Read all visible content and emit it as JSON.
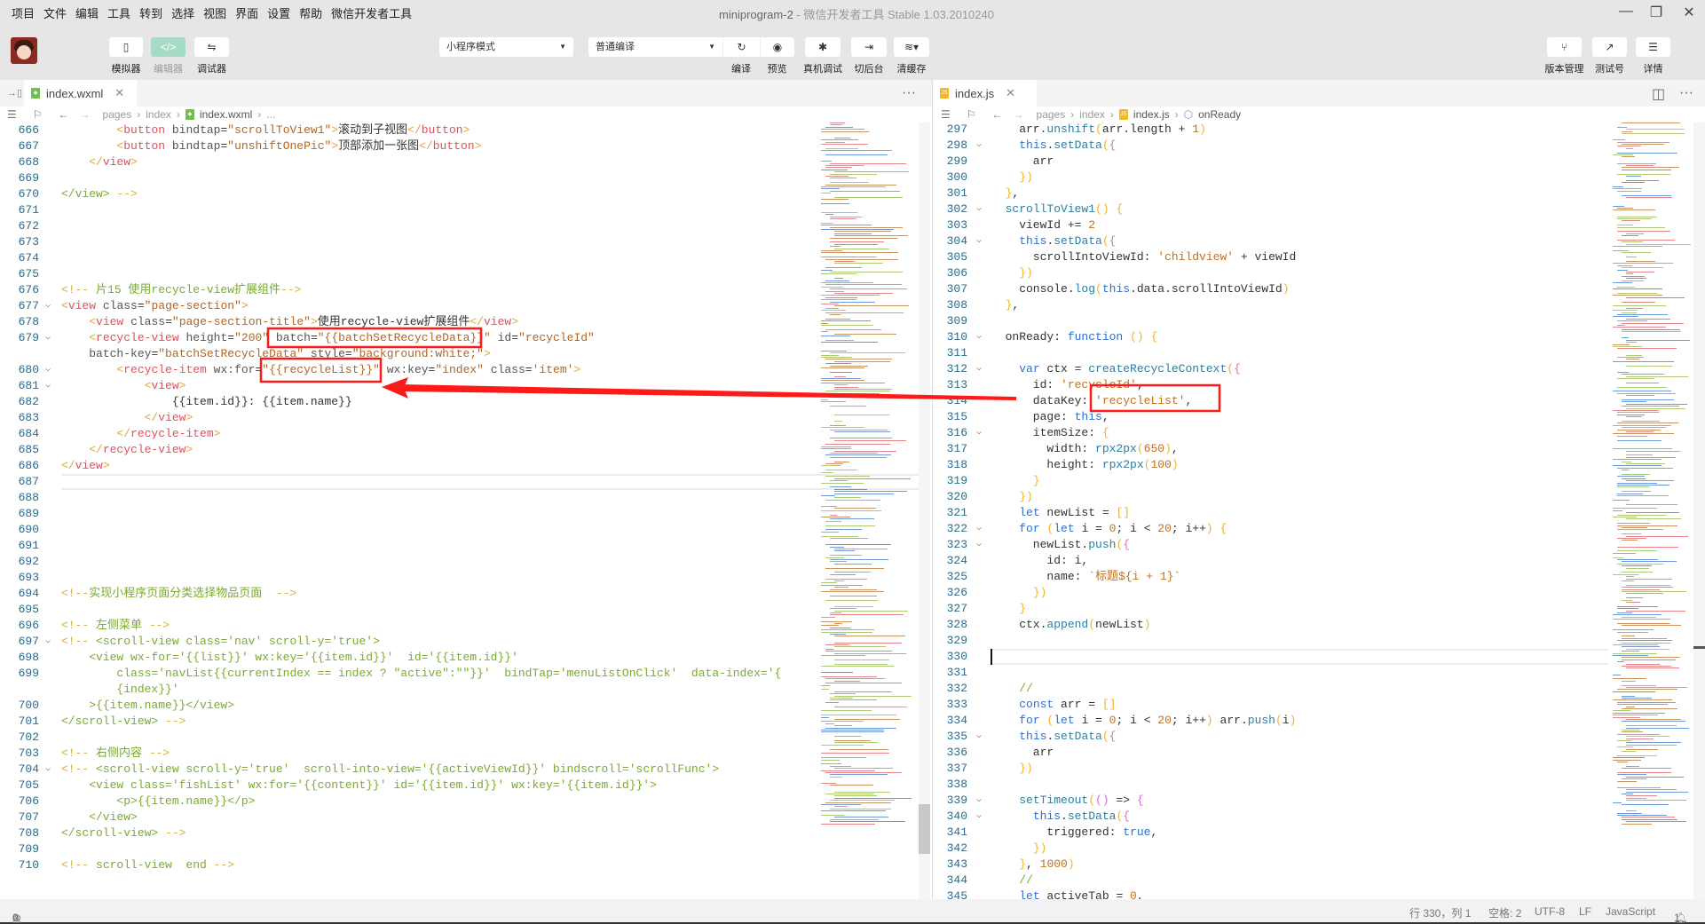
{
  "menu": [
    "项目",
    "文件",
    "编辑",
    "工具",
    "转到",
    "选择",
    "视图",
    "界面",
    "设置",
    "帮助",
    "微信开发者工具"
  ],
  "window": {
    "app_name": "miniprogram-2",
    "title_suffix": " - 微信开发者工具 Stable 1.03.2010240"
  },
  "toolbar": {
    "simulator": "模拟器",
    "editor": "编辑器",
    "debugger": "调试器",
    "mode_select": "小程序模式",
    "compile_select": "普通编译",
    "compile": "编译",
    "preview": "预览",
    "real_debug": "真机调试",
    "background": "切后台",
    "clear_cache": "清缓存",
    "version": "版本管理",
    "test_account": "测试号",
    "details": "详情",
    "accent_color": "#a6dcc5"
  },
  "left_editor": {
    "tab": "index.wxml",
    "breadcrumb": [
      "pages",
      "index",
      "index.wxml",
      "..."
    ],
    "lines": [
      {
        "n": "666",
        "t": "        <button bindtap=\"scrollToView1\">滚动到子视图</button>"
      },
      {
        "n": "667",
        "t": "        <button bindtap=\"unshiftOnePic\">顶部添加一张图</button>"
      },
      {
        "n": "668",
        "t": "    </view>"
      },
      {
        "n": "669",
        "t": ""
      },
      {
        "n": "670",
        "t": "</view> -->",
        "c": 1
      },
      {
        "n": "671",
        "t": ""
      },
      {
        "n": "672",
        "t": ""
      },
      {
        "n": "673",
        "t": ""
      },
      {
        "n": "674",
        "t": ""
      },
      {
        "n": "675",
        "t": ""
      },
      {
        "n": "676",
        "t": "<!-- 片15 使用recycle-view扩展组件-->",
        "c": 1
      },
      {
        "n": "677",
        "t": "<view class=\"page-section\">",
        "f": 1
      },
      {
        "n": "678",
        "t": "    <view class=\"page-section-title\">使用recycle-view扩展组件</view>"
      },
      {
        "n": "679",
        "t": "    <recycle-view height=\"200\" batch=\"{{batchSetRecycleData}}\" id=\"recycleId\"",
        "f": 1
      },
      {
        "n": "",
        "t": "    batch-key=\"batchSetRecycleData\" style=\"background:white;\">"
      },
      {
        "n": "680",
        "t": "        <recycle-item wx:for=\"{{recycleList}}\" wx:key=\"index\" class='item'>",
        "f": 1
      },
      {
        "n": "681",
        "t": "            <view>",
        "f": 1
      },
      {
        "n": "682",
        "t": "                {{item.id}}: {{item.name}}"
      },
      {
        "n": "683",
        "t": "            </view>"
      },
      {
        "n": "684",
        "t": "        </recycle-item>"
      },
      {
        "n": "685",
        "t": "    </recycle-view>"
      },
      {
        "n": "686",
        "t": "</view>"
      },
      {
        "n": "687",
        "t": "",
        "cur": 1
      },
      {
        "n": "688",
        "t": ""
      },
      {
        "n": "689",
        "t": ""
      },
      {
        "n": "690",
        "t": ""
      },
      {
        "n": "691",
        "t": ""
      },
      {
        "n": "692",
        "t": ""
      },
      {
        "n": "693",
        "t": ""
      },
      {
        "n": "694",
        "t": "<!--实现小程序页面分类选择物品页面  -->",
        "c": 1
      },
      {
        "n": "695",
        "t": ""
      },
      {
        "n": "696",
        "t": "<!-- 左侧菜单 -->",
        "c": 1
      },
      {
        "n": "697",
        "t": "<!-- <scroll-view class='nav' scroll-y='true'>",
        "c": 1,
        "f": 1
      },
      {
        "n": "698",
        "t": "    <view wx-for='{{list}}' wx:key='{{item.id}}'  id='{{item.id}}'",
        "c": 1
      },
      {
        "n": "699",
        "t": "        class='navList{{currentIndex == index ? \"active\":\"\"}}'  bindTap='menuListOnClick'  data-index='{",
        "c": 1
      },
      {
        "n": "",
        "t": "        {index}}'",
        "c": 1
      },
      {
        "n": "700",
        "t": "    >{{item.name}}</view>",
        "c": 1
      },
      {
        "n": "701",
        "t": "</scroll-view> -->",
        "c": 1
      },
      {
        "n": "702",
        "t": ""
      },
      {
        "n": "703",
        "t": "<!-- 右侧内容 -->",
        "c": 1
      },
      {
        "n": "704",
        "t": "<!-- <scroll-view scroll-y='true'  scroll-into-view='{{activeViewId}}' bindscroll='scrollFunc'>",
        "c": 1,
        "f": 1
      },
      {
        "n": "705",
        "t": "    <view class='fishList' wx:for='{{content}}' id='{{item.id}}' wx:key='{{item.id}}'>",
        "c": 1
      },
      {
        "n": "706",
        "t": "        <p>{{item.name}}</p>",
        "c": 1
      },
      {
        "n": "707",
        "t": "    </view>",
        "c": 1
      },
      {
        "n": "708",
        "t": "</scroll-view> -->",
        "c": 1
      },
      {
        "n": "709",
        "t": ""
      },
      {
        "n": "710",
        "t": "<!-- scroll-view  end -->",
        "c": 1
      }
    ]
  },
  "right_editor": {
    "tab": "index.js",
    "breadcrumb": [
      "pages",
      "index",
      "index.js",
      "onReady"
    ],
    "lines": [
      {
        "n": "297",
        "t": "    arr.unshift(arr.length + 1)"
      },
      {
        "n": "298",
        "t": "    this.setData({",
        "f": 1
      },
      {
        "n": "299",
        "t": "      arr"
      },
      {
        "n": "300",
        "t": "    })"
      },
      {
        "n": "301",
        "t": "  },"
      },
      {
        "n": "302",
        "t": "  scrollToView1() {",
        "f": 1
      },
      {
        "n": "303",
        "t": "    viewId += 2"
      },
      {
        "n": "304",
        "t": "    this.setData({",
        "f": 1
      },
      {
        "n": "305",
        "t": "      scrollIntoViewId: 'childview' + viewId"
      },
      {
        "n": "306",
        "t": "    })"
      },
      {
        "n": "307",
        "t": "    console.log(this.data.scrollIntoViewId)"
      },
      {
        "n": "308",
        "t": "  },"
      },
      {
        "n": "309",
        "t": ""
      },
      {
        "n": "310",
        "t": "  onReady: function () {",
        "f": 1
      },
      {
        "n": "311",
        "t": ""
      },
      {
        "n": "312",
        "t": "    var ctx = createRecycleContext({",
        "f": 1
      },
      {
        "n": "313",
        "t": "      id: 'recycleId',"
      },
      {
        "n": "314",
        "t": "      dataKey: 'recycleList',"
      },
      {
        "n": "315",
        "t": "      page: this,"
      },
      {
        "n": "316",
        "t": "      itemSize: {",
        "f": 1
      },
      {
        "n": "317",
        "t": "        width: rpx2px(650),"
      },
      {
        "n": "318",
        "t": "        height: rpx2px(100)"
      },
      {
        "n": "319",
        "t": "      }"
      },
      {
        "n": "320",
        "t": "    })"
      },
      {
        "n": "321",
        "t": "    let newList = []"
      },
      {
        "n": "322",
        "t": "    for (let i = 0; i < 20; i++) {",
        "f": 1
      },
      {
        "n": "323",
        "t": "      newList.push({",
        "f": 1
      },
      {
        "n": "324",
        "t": "        id: i,"
      },
      {
        "n": "325",
        "t": "        name: `标题${i + 1}`"
      },
      {
        "n": "326",
        "t": "      })"
      },
      {
        "n": "327",
        "t": "    }"
      },
      {
        "n": "328",
        "t": "    ctx.append(newList)"
      },
      {
        "n": "329",
        "t": ""
      },
      {
        "n": "330",
        "t": "",
        "cur": 1
      },
      {
        "n": "331",
        "t": ""
      },
      {
        "n": "332",
        "t": "    //"
      },
      {
        "n": "333",
        "t": "    const arr = []"
      },
      {
        "n": "334",
        "t": "    for (let i = 0; i < 20; i++) arr.push(i)"
      },
      {
        "n": "335",
        "t": "    this.setData({",
        "f": 1
      },
      {
        "n": "336",
        "t": "      arr"
      },
      {
        "n": "337",
        "t": "    })"
      },
      {
        "n": "338",
        "t": ""
      },
      {
        "n": "339",
        "t": "    setTimeout(() => {",
        "f": 1
      },
      {
        "n": "340",
        "t": "      this.setData({",
        "f": 1
      },
      {
        "n": "341",
        "t": "        triggered: true,"
      },
      {
        "n": "342",
        "t": "      })"
      },
      {
        "n": "343",
        "t": "    }, 1000)"
      },
      {
        "n": "344",
        "t": "    //"
      },
      {
        "n": "345",
        "t": "    let activeTab = 0,"
      }
    ]
  },
  "status": {
    "errors": "0",
    "warnings": "0",
    "position": "行 330，列 1",
    "indent": "空格: 2",
    "encoding": "UTF-8",
    "eol": "LF",
    "language": "JavaScript",
    "notifications": "1"
  },
  "annotation_color": "#ff1a1a"
}
